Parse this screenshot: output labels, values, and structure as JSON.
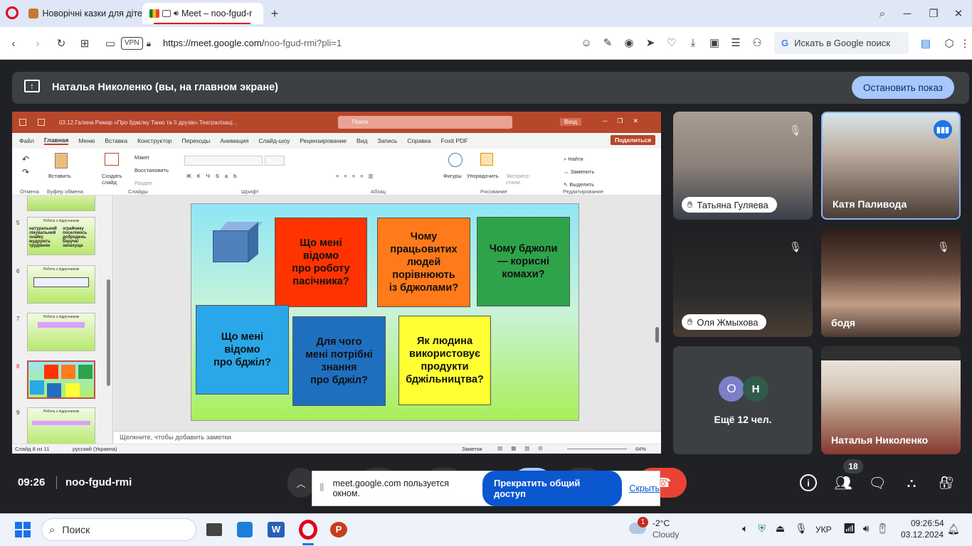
{
  "browser": {
    "tabs": [
      {
        "title": "Новорічні казки для діте"
      },
      {
        "title": "Meet – noo-fgud-r"
      }
    ],
    "url_base": "https://meet.google.com/",
    "url_path": "noo-fgud-rmi?pli=1",
    "vpn": "VPN",
    "search_placeholder": "Искать в Google поиск",
    "colors": {
      "accent": "#1a73e8",
      "opera_red": "#e0001b"
    }
  },
  "meet": {
    "presenter_banner": "Наталья Николенко (вы, на главном экране)",
    "stop_button": "Остановить показ",
    "time": "09:26",
    "meeting_code": "noo-fgud-rmi",
    "participants_count": "18",
    "share_bar": {
      "text": "meet.google.com пользуется окном.",
      "stop": "Прекратить общий доступ",
      "hide": "Скрыть"
    },
    "tiles": [
      {
        "name": "Татьяна Гуляева"
      },
      {
        "name": "Катя Паливода"
      },
      {
        "name": "Оля Жмыхова"
      },
      {
        "name": "бодя"
      },
      {
        "more": "Ещё 12 чел.",
        "avatars": [
          "О",
          "Н"
        ]
      },
      {
        "name": "Наталья Николенко"
      }
    ]
  },
  "ppt": {
    "title": "03.12.Галина Римар «Про бджілку Таню та її друзів».Театралізаці...",
    "search": "Поиск",
    "login": "Вход",
    "menu": [
      "Файл",
      "Главная",
      "Меню",
      "Вставка",
      "Конструктор",
      "Переходы",
      "Анимация",
      "Слайд-шоу",
      "Рецензирование",
      "Вид",
      "Запись",
      "Справка",
      "Foxit PDF"
    ],
    "share": "Поделиться",
    "ribbon": {
      "paste": "Вставить",
      "create_slide": "Создать слайд",
      "layout": "Макет",
      "restore": "Восстановить",
      "section": "Раздел",
      "shapes": "Фигуры",
      "arrange": "Упорядочить",
      "express": "Экспресс-стили",
      "find": "Найти",
      "replace": "Заменить",
      "select": "Выделить",
      "groups": [
        "Отмена",
        "Буфер обмена",
        "Слайды",
        "Шрифт",
        "Абзац",
        "Рисование",
        "Редактирование"
      ]
    },
    "thumbs": [
      {
        "num": "5",
        "title": "Робота з підручником",
        "words": [
          "натуральний",
          "зграйчику",
          "лікувальний",
          "поселімось",
          "знайку",
          "добродень",
          "мудрують",
          "беручкі",
          "трудівник",
          "запахуща"
        ]
      },
      {
        "num": "6",
        "title": "Робота з підручником"
      },
      {
        "num": "7",
        "title": "Робота з підручником"
      },
      {
        "num": "8",
        "title": ""
      },
      {
        "num": "9",
        "title": "Робота з підручником"
      }
    ],
    "cards": [
      "Що мені\nвідомо\nпро роботу\nпасічника?",
      "Чому\nпрацьовитих\nлюдей\nпорівнюють\nіз бджолами?",
      "Чому бджоли\n— корисні\nкомахи?",
      "Що мені\nвідомо\nпро бджіл?",
      "Для чого\nмені потрібні\nзнання\nпро бджіл?",
      "Як людина\nвикористовує\nпродукти\nбджільництва?"
    ],
    "card_colors": [
      "#ff3300",
      "#ff7a1a",
      "#2ea34a",
      "#2aa7e8",
      "#1f6fbf",
      "#ffff33"
    ],
    "notes": "Щелкните, чтобы добавить заметки",
    "status": {
      "slide": "Слайд 8 из 11",
      "lang": "русский (Украина)",
      "notes": "Заметки",
      "zoom": "64%"
    }
  },
  "taskbar": {
    "search": "Поиск",
    "weather_temp": "-2°C",
    "weather_text": "Cloudy",
    "weather_badge": "1",
    "lang": "УКР",
    "time": "09:26:54",
    "date": "03.12.2024"
  }
}
